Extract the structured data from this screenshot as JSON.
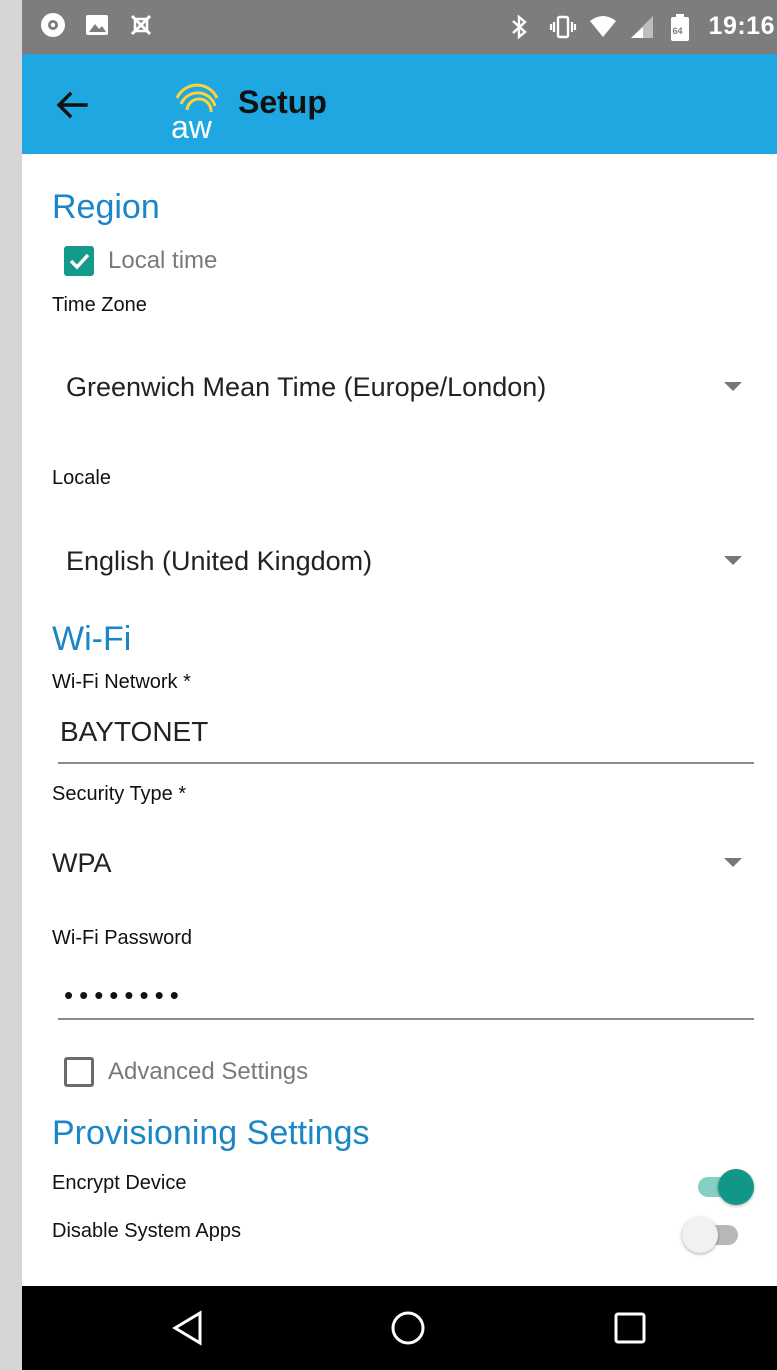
{
  "status_bar": {
    "time": "19:16",
    "left_icons": [
      "settings-notification-icon",
      "image-notification-icon",
      "debug-notification-icon"
    ],
    "right_icons": [
      "bluetooth-icon",
      "vibrate-icon",
      "wifi-icon",
      "signal-icon",
      "battery-icon"
    ],
    "battery_badge": "64"
  },
  "app_bar": {
    "title": "Setup",
    "logo_text": "aw",
    "color": "#1ea7e1"
  },
  "region": {
    "section_title": "Region",
    "local_time": {
      "label": "Local time",
      "checked": true
    },
    "time_zone": {
      "label": "Time Zone",
      "value": "Greenwich Mean Time (Europe/London)"
    },
    "locale": {
      "label": "Locale",
      "value": "English (United Kingdom)"
    }
  },
  "wifi": {
    "section_title": "Wi-Fi",
    "network": {
      "label": "Wi-Fi Network *",
      "value": "BAYTONET"
    },
    "security": {
      "label": "Security Type *",
      "value": "WPA"
    },
    "password": {
      "label": "Wi-Fi Password",
      "masked": "••••••••"
    },
    "advanced": {
      "label": "Advanced Settings",
      "checked": false
    }
  },
  "provisioning": {
    "section_title": "Provisioning Settings",
    "encrypt_device": {
      "label": "Encrypt Device",
      "on": true
    },
    "disable_system_apps": {
      "label": "Disable System Apps",
      "on": false
    }
  },
  "colors": {
    "accent": "#1a86c8",
    "teal": "#129a8a"
  },
  "nav_bar": {
    "buttons": [
      "back-nav-icon",
      "home-nav-icon",
      "recents-nav-icon"
    ]
  }
}
